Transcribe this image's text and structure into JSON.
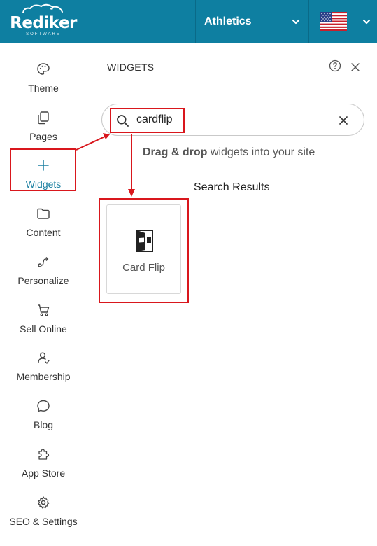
{
  "header": {
    "logo_text": "Rediker",
    "logo_sub": "SOFTWARE",
    "site_name": "Athletics",
    "language_flag": "us-flag-icon"
  },
  "sidebar": {
    "items": [
      {
        "label": "Theme",
        "icon": "palette-icon"
      },
      {
        "label": "Pages",
        "icon": "pages-icon"
      },
      {
        "label": "Widgets",
        "icon": "plus-icon",
        "active": true
      },
      {
        "label": "Content",
        "icon": "folder-icon"
      },
      {
        "label": "Personalize",
        "icon": "route-icon"
      },
      {
        "label": "Sell Online",
        "icon": "cart-icon"
      },
      {
        "label": "Membership",
        "icon": "member-icon"
      },
      {
        "label": "Blog",
        "icon": "chat-bubble-icon"
      },
      {
        "label": "App Store",
        "icon": "puzzle-icon"
      },
      {
        "label": "SEO & Settings",
        "icon": "gear-icon"
      }
    ]
  },
  "panel": {
    "title": "WIDGETS",
    "search": {
      "value": "cardflip"
    },
    "hint_bold": "Drag & drop",
    "hint_rest": " widgets into your site",
    "results_title": "Search Results",
    "results": [
      {
        "label": "Card Flip",
        "icon": "card-flip-icon"
      }
    ]
  },
  "colors": {
    "header_bg": "#0e7fa1",
    "accent": "#1a7fa1",
    "annotation": "#d9171d"
  }
}
